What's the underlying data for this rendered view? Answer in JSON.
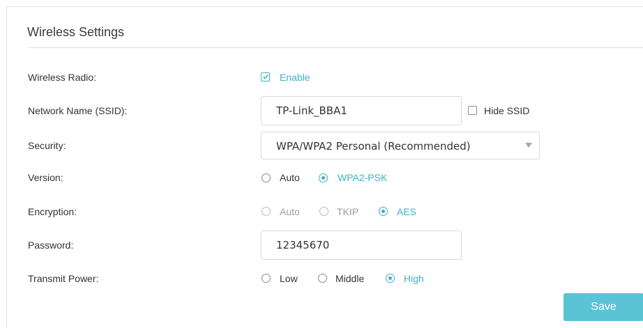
{
  "section": {
    "title": "Wireless Settings"
  },
  "wireless_radio": {
    "label": "Wireless Radio:",
    "option": "Enable",
    "checked": true
  },
  "ssid": {
    "label": "Network Name (SSID):",
    "value": "TP-Link_BBA1",
    "hide_label": "Hide SSID",
    "hide_checked": false
  },
  "security": {
    "label": "Security:",
    "value": "WPA/WPA2 Personal (Recommended)"
  },
  "version": {
    "label": "Version:",
    "options": [
      "Auto",
      "WPA2-PSK"
    ],
    "selected": "WPA2-PSK"
  },
  "encryption": {
    "label": "Encryption:",
    "options": [
      "Auto",
      "TKIP",
      "AES"
    ],
    "selected": "AES"
  },
  "password": {
    "label": "Password:",
    "value": "12345670"
  },
  "transmit_power": {
    "label": "Transmit Power:",
    "options": [
      "Low",
      "Middle",
      "High"
    ],
    "selected": "High"
  },
  "actions": {
    "save_label": "Save"
  },
  "colors": {
    "accent": "#3cb1c8",
    "button": "#5bc3d6"
  },
  "icons": {
    "checkbox_checked": "check-icon",
    "select_arrow": "chevron-down-icon"
  }
}
